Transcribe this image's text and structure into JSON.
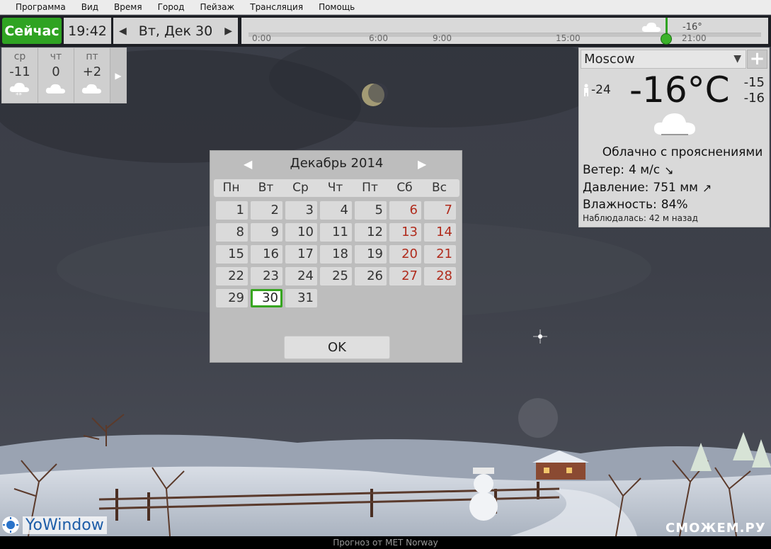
{
  "menu": [
    "Программа",
    "Вид",
    "Время",
    "Город",
    "Пейзаж",
    "Трансляция",
    "Помощь"
  ],
  "topbar": {
    "now_label": "Сейчас",
    "time": "19:42",
    "date": "Вт, Дек 30",
    "timeline_ticks": [
      "0:00",
      "6:00",
      "9:00",
      "15:00",
      "21:00"
    ],
    "timeline_temp": "-16°"
  },
  "forecast": {
    "days": [
      {
        "name": "ср",
        "temp": "-11",
        "icon": "snow-cloud-icon"
      },
      {
        "name": "чт",
        "temp": "0",
        "icon": "cloud-icon"
      },
      {
        "name": "пт",
        "temp": "+2",
        "icon": "cloud-icon"
      }
    ]
  },
  "weather": {
    "city": "Moscow",
    "feels_like": "-24",
    "temp": "-16°C",
    "high": "-15",
    "low": "-16",
    "condition": "Облачно с прояснениями",
    "wind_label": "Ветер:",
    "wind_value": "4 м/с",
    "pressure_label": "Давление:",
    "pressure_value": "751 мм",
    "humidity_label": "Влажность:",
    "humidity_value": "84%",
    "observed_label": "Наблюдалась:",
    "observed_value": "42 м назад"
  },
  "calendar": {
    "title": "Декабрь 2014",
    "weekdays": [
      "Пн",
      "Вт",
      "Ср",
      "Чт",
      "Пт",
      "Сб",
      "Вс"
    ],
    "weeks": [
      [
        "1",
        "2",
        "3",
        "4",
        "5",
        "6",
        "7"
      ],
      [
        "8",
        "9",
        "10",
        "11",
        "12",
        "13",
        "14"
      ],
      [
        "15",
        "16",
        "17",
        "18",
        "19",
        "20",
        "21"
      ],
      [
        "22",
        "23",
        "24",
        "25",
        "26",
        "27",
        "28"
      ],
      [
        "29",
        "30",
        "31",
        "",
        "",
        "",
        ""
      ]
    ],
    "selected": "30",
    "ok_label": "OK"
  },
  "status": {
    "forecast_source": "Прогноз от MET Norway",
    "brand": "YoWindow",
    "watermark": "СМОЖЕМ.РУ"
  },
  "colors": {
    "accent": "#2fa322",
    "weekend": "#b02b1c"
  }
}
